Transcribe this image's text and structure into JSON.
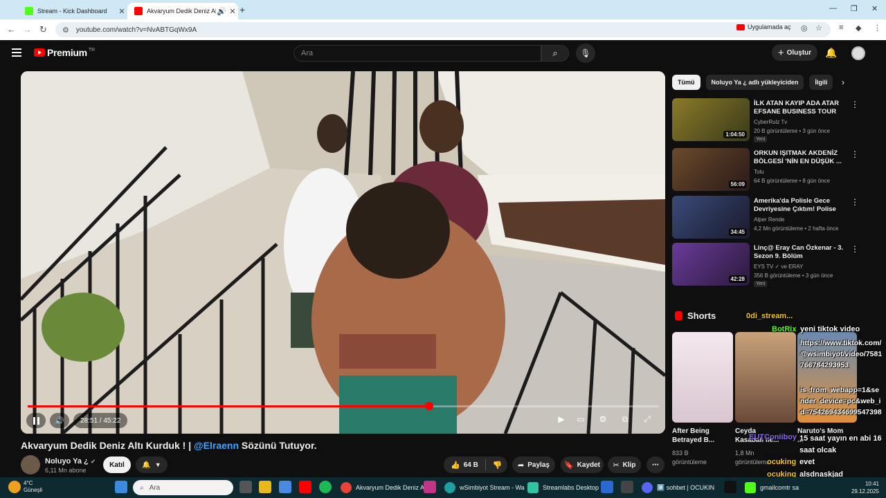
{
  "browser": {
    "tabs": [
      {
        "title": "Stream - Kick Dashboard",
        "favicon_color": "#53fc18"
      },
      {
        "title": "Akvaryum Dedik Deniz Altı",
        "favicon_color": "#ff0000"
      }
    ],
    "url": "youtube.com/watch?v=NvABTGqWx9A",
    "open_in_app": "Uygulamada aç"
  },
  "header": {
    "logo": "Premium",
    "region": "TR",
    "search_placeholder": "Ara",
    "create_label": "Oluştur"
  },
  "player": {
    "time": "28:51 / 45:22",
    "progress_fraction": 0.636
  },
  "video": {
    "title_prefix": "Akvaryum Dedik Deniz Altı Kurduk ! |",
    "title_mention": "@Elraenn",
    "title_suffix": "Sözünü Tutuyor.",
    "channel": "Noluyo Ya ¿",
    "subscribers": "6,11 Mn abone",
    "join_label": "Katıl",
    "likes": "64 B",
    "share_label": "Paylaş",
    "save_label": "Kaydet",
    "clip_label": "Klip"
  },
  "chips": [
    "Tümü",
    "Noluyo Ya ¿ adlı yükleyiciden",
    "İlgili"
  ],
  "recommendations": [
    {
      "title": "İLK ATAN KAYIP ADA ATAR EFSANE BUSINESS TOUR",
      "channel": "CyberRulz Tv",
      "meta": "20 B görüntüleme • 3 gün önce",
      "duration": "1:04:50",
      "badge": "Yeni",
      "thumb_color": "#7a6a2a"
    },
    {
      "title": "ORKUN IŞITMAK AKDENİZ BÖLGESİ 'NİN EN DÜŞÜK ...",
      "channel": "Tolu",
      "meta": "64 B görüntüleme • 8 gün önce",
      "duration": "56:09",
      "badge": "",
      "thumb_color": "#4a3a2a"
    },
    {
      "title": "Amerika'da Polisle Gece Devriyesine Çıktım! Polise Küf...",
      "channel": "Alper Rende",
      "meta": "4,2 Mn görüntüleme • 2 hafta önce",
      "duration": "34:45",
      "badge": "",
      "thumb_color": "#2a3550"
    },
    {
      "title": "Linç@ Eray Can Özkenar - 3. Sezon 9. Bölüm",
      "channel": "EYS TV ✓ ve ERAY",
      "meta": "356 B görüntüleme • 3 gün önce",
      "duration": "42:28",
      "badge": "Yeni",
      "thumb_color": "#4a2a6a"
    }
  ],
  "shorts": {
    "heading": "Shorts",
    "items": [
      {
        "title": "After Being Betrayed B...",
        "views": "833 B görüntüleme"
      },
      {
        "title": "Ceyda Kasabalı ile...",
        "views": "1,8 Mn görüntüleme"
      },
      {
        "title": "Naruto's Mom ...",
        "views": ""
      }
    ]
  },
  "chat_overlay": [
    {
      "user": "0di_stream...",
      "text": ""
    },
    {
      "user": "BotRix",
      "text": "yeni tiktok video"
    },
    {
      "user": "",
      "text": "https://www.tiktok.com/@wsimbiyot/video/7581766784293953"
    },
    {
      "user": "",
      "text": "is_from_webapp=1&sender_device=pc&web_id=754269434699547398"
    },
    {
      "user": "EUTConiiboy",
      "text": "15 saat yayın en abi 16 saat olcak"
    },
    {
      "user": "ocuking",
      "text": "evet"
    },
    {
      "user": "ocuking",
      "text": "alsdnaskjad"
    }
  ],
  "taskbar": {
    "weather_temp": "4°C",
    "weather_desc": "Güneşli",
    "search": "Ara",
    "apps": [
      "Akvaryum Dedik Deniz A",
      "wSimbiyot Stream - Wa",
      "Streamlabs Desktop",
      "#️⃣ sohbet | OCUKIN",
      "gmailcomtr sa"
    ],
    "time": "10:41",
    "date": "29.12.2025"
  }
}
